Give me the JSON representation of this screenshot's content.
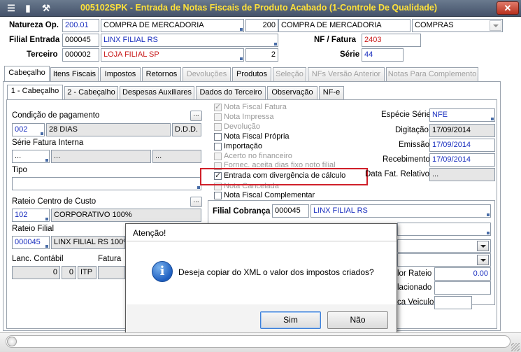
{
  "window": {
    "title": "005102SPK - Entrada de Notas Fiscais de Produto Acabado (1-Controle De Qualidade)",
    "close": "✕"
  },
  "header": {
    "natureza_label": "Natureza Op.",
    "natureza_code": "200.01",
    "natureza_desc": "COMPRA DE MERCADORIA",
    "natureza_num": "200",
    "natureza_desc2": "COMPRA DE MERCADORIA",
    "natureza_tipo": "COMPRAS",
    "filial_label": "Filial Entrada",
    "filial_code": "000045",
    "filial_desc": "LINX FILIAL RS",
    "nf_label": "NF / Fatura",
    "nf_value": "2403",
    "terceiro_label": "Terceiro",
    "terceiro_code": "000002",
    "terceiro_desc": "LOJA FILIAL SP",
    "terceiro_num": "2",
    "serie_label": "Série",
    "serie_value": "44"
  },
  "tabs": {
    "main": [
      "Cabeçalho",
      "Itens Fiscais",
      "Impostos",
      "Retornos",
      "Devoluções",
      "Produtos",
      "Seleção",
      "NFs Versão Anterior",
      "Notas Para Complemento"
    ],
    "sub": [
      "1 - Cabeçalho",
      "2 - Cabeçalho",
      "Despesas Auxiliares",
      "Dados do Terceiro",
      "Observação",
      "NF-e"
    ]
  },
  "left": {
    "cond_label": "Condição de pagamento",
    "cond_code": "002",
    "cond_desc": "28 DIAS",
    "cond_ddd": "D.D.D.",
    "serie_int_label": "Série Fatura Interna",
    "serie_int_1": "...",
    "serie_int_2": "...",
    "serie_int_3": "...",
    "tipo_label": "Tipo",
    "rateio_cc_label": "Rateio Centro de Custo",
    "rateio_cc_code": "102",
    "rateio_cc_desc": "CORPORATIVO 100%",
    "rateio_filial_label": "Rateio Filial",
    "rateio_filial_code": "000045",
    "rateio_filial_desc": "LINX FILIAL RS 100%",
    "lanc_label": "Lanc. Contábil",
    "fatura_label": "Fatura",
    "lanc_v1": "0",
    "lanc_v2": "0",
    "lanc_v3": "ITP",
    "dots": "..."
  },
  "checks": [
    {
      "label": "Nota Fiscal Fatura",
      "checked": true,
      "disabled": true
    },
    {
      "label": "Nota Impressa",
      "checked": false,
      "disabled": true
    },
    {
      "label": "Devolução",
      "checked": false,
      "disabled": true
    },
    {
      "label": "Nota Fiscal Própria",
      "checked": false,
      "disabled": false
    },
    {
      "label": "Importação",
      "checked": false,
      "disabled": false
    },
    {
      "label": "Acerto no financeiro",
      "checked": false,
      "disabled": true
    },
    {
      "label": "Fornec. aceita dias fixo noto filial",
      "checked": false,
      "disabled": true
    },
    {
      "label": "Entrada com divergência de cálculo",
      "checked": true,
      "disabled": false
    },
    {
      "label": "Nota Cancelada",
      "checked": false,
      "disabled": true
    },
    {
      "label": "Nota Fiscal Complementar",
      "checked": false,
      "disabled": false
    }
  ],
  "right": {
    "especie_label": "Espécie Série",
    "especie_value": "NFE",
    "digitacao_label": "Digitação",
    "digitacao_value": "17/09/2014",
    "emissao_label": "Emissão",
    "emissao_value": "17/09/2014",
    "recebimento_label": "Recebimento",
    "recebimento_value": "17/09/2014",
    "datafat_label": "Data Fat. Relativo",
    "datafat_value": "...",
    "filial_cob_label": "Filial Cobrança",
    "filial_cob_code": "000045",
    "filial_cob_desc": "LINX FILIAL RS",
    "valor_rateio_label": "lor Rateio",
    "valor_rateio_value": "0.00",
    "relacionado_label": "lacionado",
    "veiculo_label": "ca Veiculo"
  },
  "dialog": {
    "title": "Atenção!",
    "message": "Deseja copiar do XML o valor dos impostos criados?",
    "yes": "Sim",
    "no": "Não",
    "icon": "i"
  }
}
